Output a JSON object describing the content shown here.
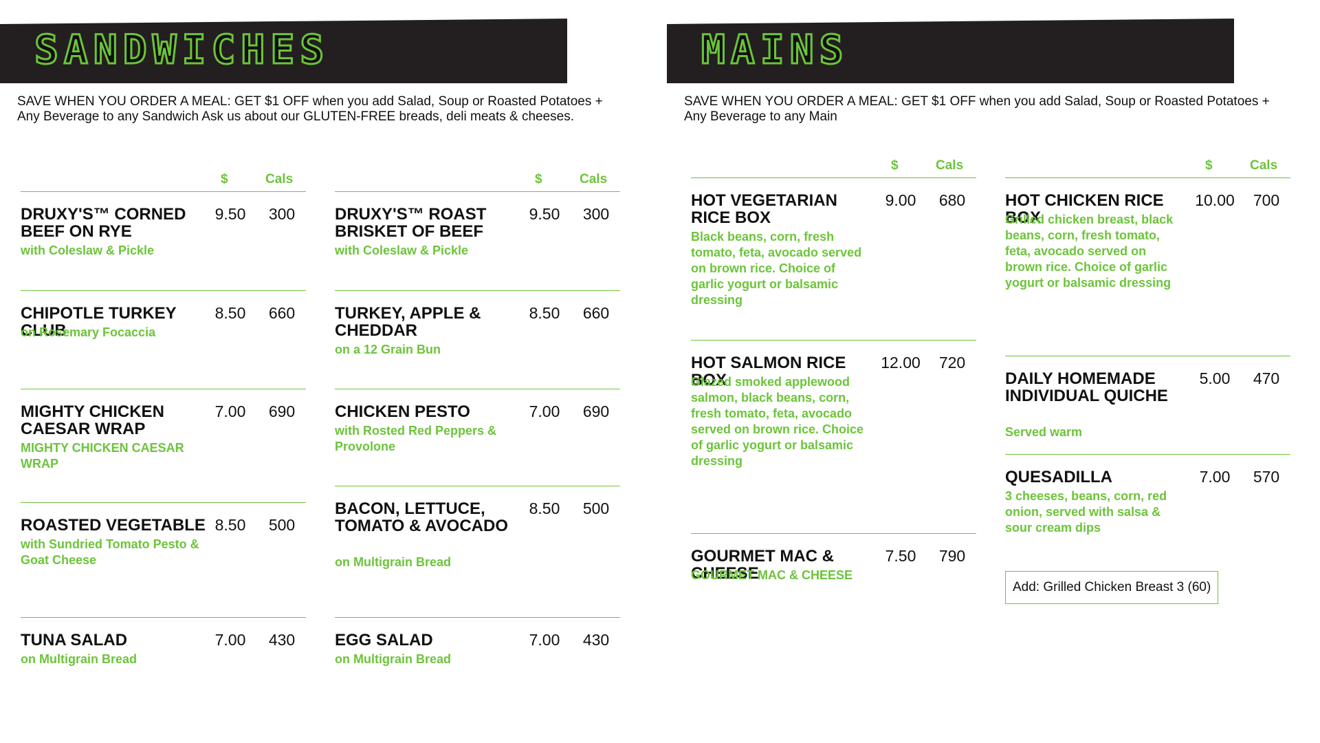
{
  "sandwiches": {
    "title": "SANDWICHES",
    "promo": "SAVE WHEN YOU ORDER A MEAL: GET $1 OFF when you add Salad, Soup or Roasted Potatoes + Any Beverage to any Sandwich Ask us about our GLUTEN-FREE breads, deli meats & cheeses.",
    "headers": {
      "price": "$",
      "cals": "Cals"
    },
    "columns": [
      [
        {
          "name": "DRUXY'S™ CORNED BEEF ON RYE",
          "desc": "with Coleslaw & Pickle",
          "price": "9.50",
          "cals": "300"
        },
        {
          "name": "CHIPOTLE TURKEY CLUB",
          "desc": "on Rosemary Focaccia",
          "price": "8.50",
          "cals": "660"
        },
        {
          "name": "MIGHTY CHICKEN CAESAR WRAP",
          "desc": "MIGHTY CHICKEN CAESAR WRAP",
          "price": "7.00",
          "cals": "690"
        },
        {
          "name": "ROASTED VEGETABLE",
          "desc": "with Sundried Tomato Pesto & Goat Cheese",
          "price": "8.50",
          "cals": "500"
        },
        {
          "name": "TUNA SALAD",
          "desc": "on Multigrain Bread",
          "price": "7.00",
          "cals": "430"
        }
      ],
      [
        {
          "name": "DRUXY'S™ ROAST BRISKET OF BEEF",
          "desc": "with Coleslaw & Pickle",
          "price": "9.50",
          "cals": "300"
        },
        {
          "name": "TURKEY, APPLE & CHEDDAR",
          "desc": "on a 12 Grain Bun",
          "price": "8.50",
          "cals": "660"
        },
        {
          "name": "CHICKEN PESTO",
          "desc": "with Rosted Red Peppers & Provolone",
          "price": "7.00",
          "cals": "690"
        },
        {
          "name": "BACON, LETTUCE, TOMATO & AVOCADO",
          "desc": "on Multigrain Bread",
          "price": "8.50",
          "cals": "500"
        },
        {
          "name": "EGG SALAD",
          "desc": "on Multigrain Bread",
          "price": "7.00",
          "cals": "430"
        }
      ]
    ]
  },
  "mains": {
    "title": "MAINS",
    "promo": "SAVE WHEN YOU ORDER A MEAL: GET $1 OFF when you add Salad, Soup or Roasted Potatoes + Any Beverage to any Main",
    "headers": {
      "price": "$",
      "cals": "Cals"
    },
    "columns": [
      [
        {
          "name": "HOT VEGETARIAN RICE BOX",
          "desc": "Black beans, corn, fresh tomato, feta, avocado served on brown rice. Choice of garlic yogurt or balsamic dressing",
          "price": "9.00",
          "cals": "680"
        },
        {
          "name": "HOT SALMON RICE BOX",
          "desc": "Glazed smoked applewood salmon, black beans, corn, fresh tomato, feta, avocado served on brown rice. Choice of garlic yogurt or balsamic dressing",
          "price": "12.00",
          "cals": "720"
        },
        {
          "name": "GOURMET MAC & CHEESE",
          "desc": "GOURMET MAC & CHEESE",
          "price": "7.50",
          "cals": "790"
        }
      ],
      [
        {
          "name": "HOT CHICKEN RICE BOX",
          "desc": "Grilled chicken breast, black beans, corn, fresh tomato, feta, avocado served on brown rice. Choice of garlic yogurt or balsamic dressing",
          "price": "10.00",
          "cals": "700"
        },
        {
          "name": "DAILY HOMEMADE INDIVIDUAL QUICHE",
          "desc": "Served warm",
          "price": "5.00",
          "cals": "470"
        },
        {
          "name": "QUESADILLA",
          "desc": "3 cheeses, beans, corn, red onion, served with salsa & sour cream dips",
          "price": "7.00",
          "cals": "570"
        }
      ]
    ],
    "addon": "Add: Grilled Chicken Breast 3 (60)"
  },
  "colors": {
    "accent": "#6cc43a",
    "banner": "#231f20",
    "text": "#111111"
  }
}
